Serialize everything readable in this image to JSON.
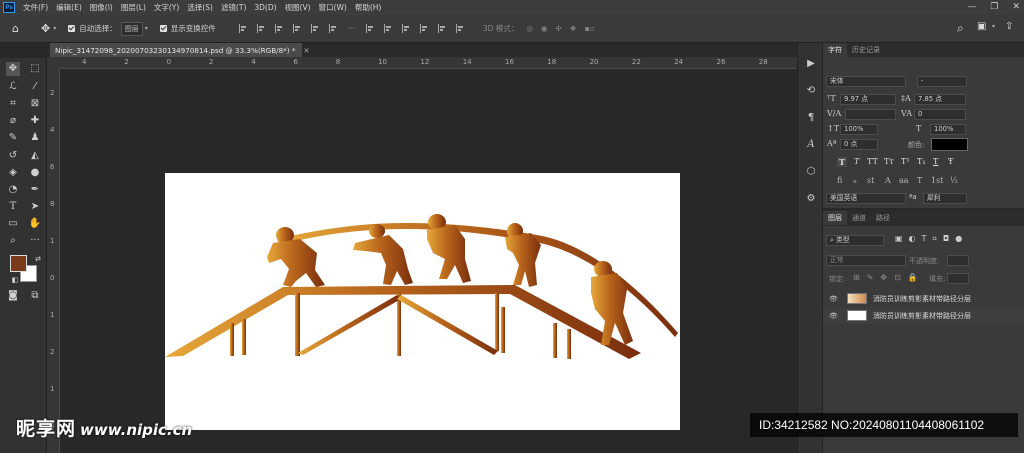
{
  "app": {
    "logo": "Ps",
    "window_controls": [
      "—",
      "❐",
      "✕"
    ]
  },
  "menu": [
    "文件(F)",
    "编辑(E)",
    "图像(I)",
    "图层(L)",
    "文字(Y)",
    "选择(S)",
    "滤镜(T)",
    "3D(D)",
    "视图(V)",
    "窗口(W)",
    "帮助(H)"
  ],
  "options": {
    "auto_select_label": "自动选择：",
    "auto_select_value": "图层",
    "show_transform_label": "显示变换控件",
    "mode3d_label": "3D 模式："
  },
  "document": {
    "tab_title": "Nipic_31472098_20200703230134970814.psd @ 33.3%(RGB/8*) *",
    "ruler_h": [
      "4",
      "2",
      "0",
      "2",
      "4",
      "6",
      "8",
      "10",
      "12",
      "14",
      "16",
      "18",
      "20",
      "22",
      "24",
      "26",
      "28"
    ],
    "ruler_v": [
      "2",
      "4",
      "6",
      "8",
      "1",
      "0",
      "1",
      "2",
      "1",
      "4"
    ]
  },
  "colors": {
    "foreground": "#7a3a1c",
    "background": "#ffffff",
    "accent": "#2d9bf0",
    "silhouette_start": "#e7a83a",
    "silhouette_end": "#7a2e0e"
  },
  "char_panel": {
    "tabs": [
      "字符",
      "历史记录"
    ],
    "font_family": "宋体",
    "font_style": "-",
    "font_size": "9.97 点",
    "leading": "7.85 点",
    "kerning": "",
    "tracking": "0",
    "vscale": "100%",
    "hscale": "100%",
    "baseline": "0 点",
    "color_label": "颜色:",
    "color_value": "#000000",
    "style_buttons": [
      "T",
      "T",
      "TT",
      "Tт",
      "T¹",
      "T₁",
      "T",
      "Ŧ"
    ],
    "opentype_buttons": [
      "fi",
      "ℴ",
      "st",
      "A",
      "aa",
      "T",
      "1st",
      "½"
    ],
    "language": "美国英语",
    "aa_label": "ªa",
    "antialias": "犀利"
  },
  "layers_panel": {
    "tabs": [
      "图层",
      "通道",
      "路径"
    ],
    "filter_label": "类型",
    "blend_mode": "正常",
    "opacity_label": "不透明度:",
    "lock_label": "锁定:",
    "fill_label": "填充:",
    "layers": [
      {
        "name": "消防员训练剪影素材带路径分层",
        "visible": true
      },
      {
        "name": "消防员训练剪影素材带路径分层",
        "visible": true
      }
    ]
  },
  "watermark": {
    "site_name": "昵享网",
    "site_url": "www.nipic.cn",
    "id_text": "ID:34212582 NO:20240801104408061102"
  }
}
